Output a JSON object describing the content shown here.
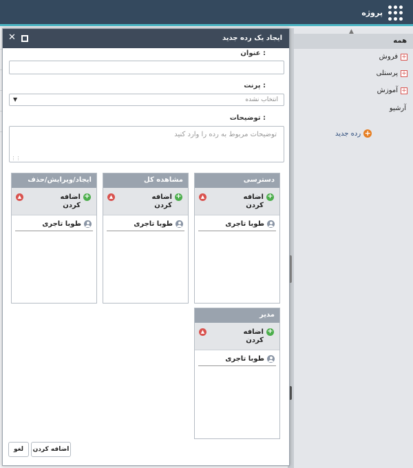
{
  "app": {
    "title": "پروژه",
    "menu_icon": "grid-menu-icon"
  },
  "sidebar": {
    "all_label": "همه",
    "items": [
      {
        "label": "فروش",
        "icon": "plus-square-icon"
      },
      {
        "label": "پرسنلی",
        "icon": "plus-square-icon"
      },
      {
        "label": "آموزش",
        "icon": "plus-square-icon"
      },
      {
        "label": "آرشیو",
        "icon": ""
      }
    ],
    "new_category_label": "رده جدید"
  },
  "modal": {
    "title": "ایجاد یک رده جدید",
    "title_field": {
      "label": "عنوان :",
      "value": "",
      "placeholder": ""
    },
    "parent_field": {
      "label": "پرنت :",
      "selected": "انتخاب نشده"
    },
    "description_field": {
      "label": "توضیحات :",
      "placeholder": "توضیحات مربوط به رده را وارد کنید"
    },
    "permission_cards": [
      {
        "title": "دسترسی",
        "add_label": "اضافه کردن",
        "users": [
          "طوبا تاجری"
        ]
      },
      {
        "title": "مشاهده کل",
        "add_label": "اضافه کردن",
        "users": [
          "طوبا تاجری"
        ]
      },
      {
        "title": "ایجاد/ویرایش/حذف",
        "add_label": "اضافه کردن",
        "users": [
          "طوبا تاجری"
        ]
      },
      {
        "title": "مدیر",
        "add_label": "اضافه کردن",
        "users": [
          "طوبا تاجری"
        ]
      }
    ],
    "buttons": {
      "submit": "اضافه کردن",
      "cancel": "لغو"
    }
  },
  "colors": {
    "topbar": "#34495e",
    "accent_line": "#4db6c4",
    "modal_header": "#3e4a5a",
    "card_header": "#9aa3ae",
    "add_green": "#4cae4c",
    "delete_red": "#d9534f",
    "new_orange": "#e67e22"
  }
}
